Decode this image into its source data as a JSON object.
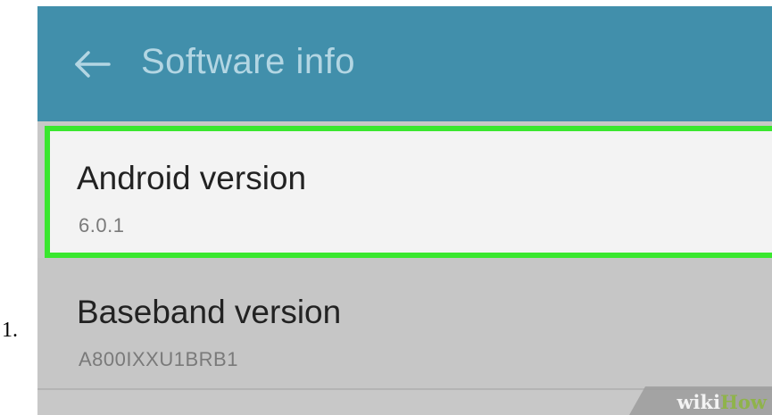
{
  "step": {
    "number": "1."
  },
  "app_bar": {
    "back_icon": "arrow-left-icon",
    "title": "Software info"
  },
  "settings": [
    {
      "title": "Android version",
      "value": "6.0.1",
      "highlighted": true
    },
    {
      "title": "Baseband version",
      "value": "A800IXXU1BRB1",
      "highlighted": false
    }
  ],
  "watermark": {
    "wiki": "wiki",
    "how": "How"
  },
  "colors": {
    "app_bar": "#418fab",
    "highlight_border": "#3ae72f",
    "watermark_green": "#8fb34b"
  }
}
